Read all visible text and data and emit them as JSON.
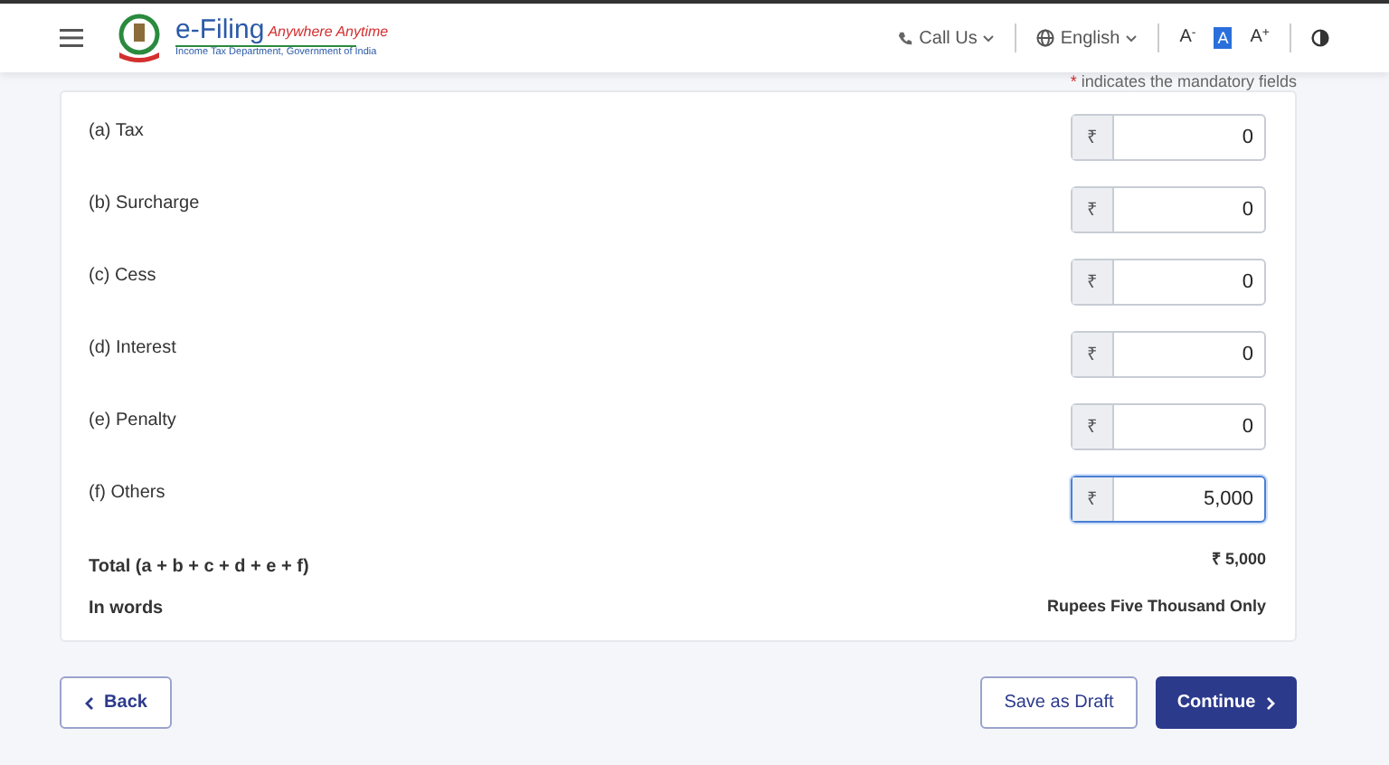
{
  "header": {
    "logo_title": "e-Filing",
    "logo_tagline": "Anywhere Anytime",
    "logo_subtitle": "Income Tax Department, Government of India",
    "call_us": "Call Us",
    "language": "English",
    "font_sizes": [
      {
        "label": "A",
        "sign": "-",
        "selected": false
      },
      {
        "label": "A",
        "selected": true
      },
      {
        "label": "A",
        "sign": "+",
        "selected": false
      }
    ]
  },
  "mandatory_note": {
    "mark": "*",
    "text": "indicates the mandatory fields"
  },
  "fields": [
    {
      "label": "(a) Tax",
      "currency": "₹",
      "value": "0",
      "focused": false
    },
    {
      "label": "(b) Surcharge",
      "currency": "₹",
      "value": "0",
      "focused": false
    },
    {
      "label": "(c) Cess",
      "currency": "₹",
      "value": "0",
      "focused": false
    },
    {
      "label": "(d) Interest",
      "currency": "₹",
      "value": "0",
      "focused": false
    },
    {
      "label": "(e) Penalty",
      "currency": "₹",
      "value": "0",
      "focused": false
    },
    {
      "label": "(f) Others",
      "currency": "₹",
      "value": "5,000",
      "focused": true
    }
  ],
  "total": {
    "label": "Total (a + b + c + d + e + f)",
    "value": "₹ 5,000"
  },
  "in_words": {
    "label": "In words",
    "value": "Rupees Five Thousand Only"
  },
  "buttons": {
    "back": "Back",
    "save_draft": "Save as Draft",
    "continue": "Continue"
  }
}
